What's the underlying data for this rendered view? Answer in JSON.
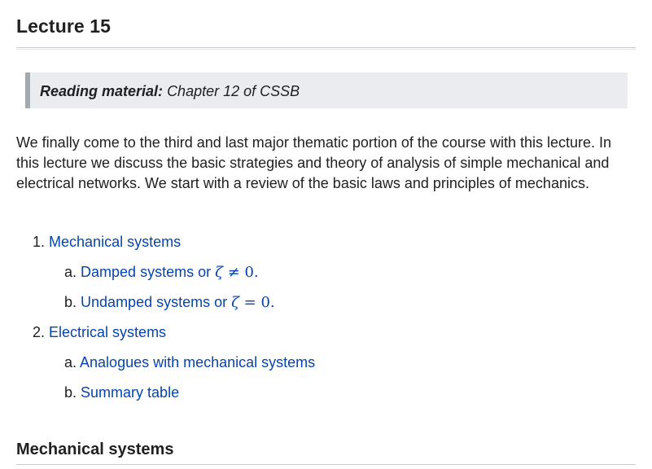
{
  "page": {
    "title": "Lecture 15"
  },
  "callout": {
    "label": "Reading material:",
    "text": "Chapter 12 of CSSB"
  },
  "intro": {
    "paragraph": "We finally come to the third and last major thematic portion of the course with this lecture. In this lecture we discuss the basic strategies and theory of analysis of simple mechanical and electrical networks. We start with a review of the basic laws and principles of mechanics."
  },
  "toc": {
    "items": [
      {
        "marker": "1.",
        "label": "Mechanical systems",
        "subitems": [
          {
            "marker": "a.",
            "label": "Damped systems or",
            "math_var": "ζ",
            "math_rel": "≠",
            "math_val": "0",
            "math_end": "."
          },
          {
            "marker": "b.",
            "label": "Undamped systems or",
            "math_var": "ζ",
            "math_rel": "=",
            "math_val": "0",
            "math_end": "."
          }
        ]
      },
      {
        "marker": "2.",
        "label": "Electrical systems",
        "subitems": [
          {
            "marker": "a.",
            "label": "Analogues with mechanical systems"
          },
          {
            "marker": "b.",
            "label": "Summary table"
          }
        ]
      }
    ]
  },
  "section": {
    "heading": "Mechanical systems"
  },
  "colors": {
    "link": "#0645ad",
    "text": "#202122",
    "callout_bg": "#eaecf0",
    "callout_border": "#a2a9b1"
  }
}
